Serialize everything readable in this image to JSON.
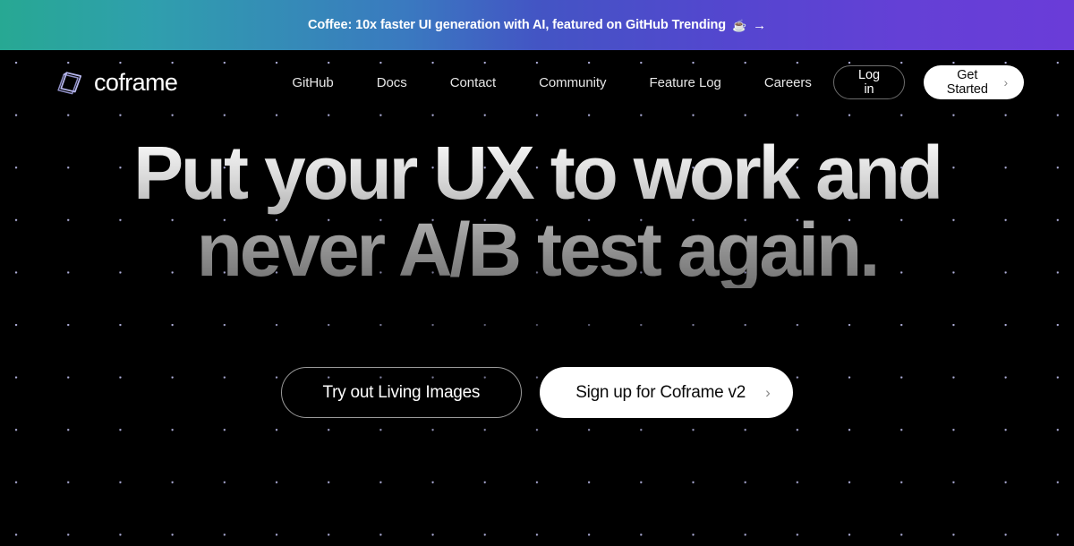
{
  "banner": {
    "text": "Coffee: 10x faster UI generation with AI, featured on GitHub Trending",
    "emoji": "☕",
    "arrow": "→",
    "gradient_start": "#27a893",
    "gradient_mid": "#4355c4",
    "gradient_end": "#6a3cd8"
  },
  "header": {
    "logo_text": "coframe",
    "logo_icon": "coframe-cube-icon",
    "logo_color": "#b9b9f0",
    "nav": [
      {
        "label": "GitHub"
      },
      {
        "label": "Docs"
      },
      {
        "label": "Contact"
      },
      {
        "label": "Community"
      },
      {
        "label": "Feature Log"
      },
      {
        "label": "Careers"
      }
    ],
    "login_label": "Log in",
    "get_started_label": "Get Started",
    "get_started_chevron": "›"
  },
  "hero": {
    "headline_line_1": "Put your UX to work and",
    "headline_line_2": "never A/B test again.",
    "cta_secondary": "Try out Living Images",
    "cta_primary": "Sign up for Coframe v2",
    "cta_primary_chevron": "›"
  },
  "theme": {
    "background": "#000000",
    "text_primary": "#ffffff",
    "star_color": "#babae8",
    "accent_purple": "#6a3cd8",
    "accent_teal": "#27a893"
  }
}
